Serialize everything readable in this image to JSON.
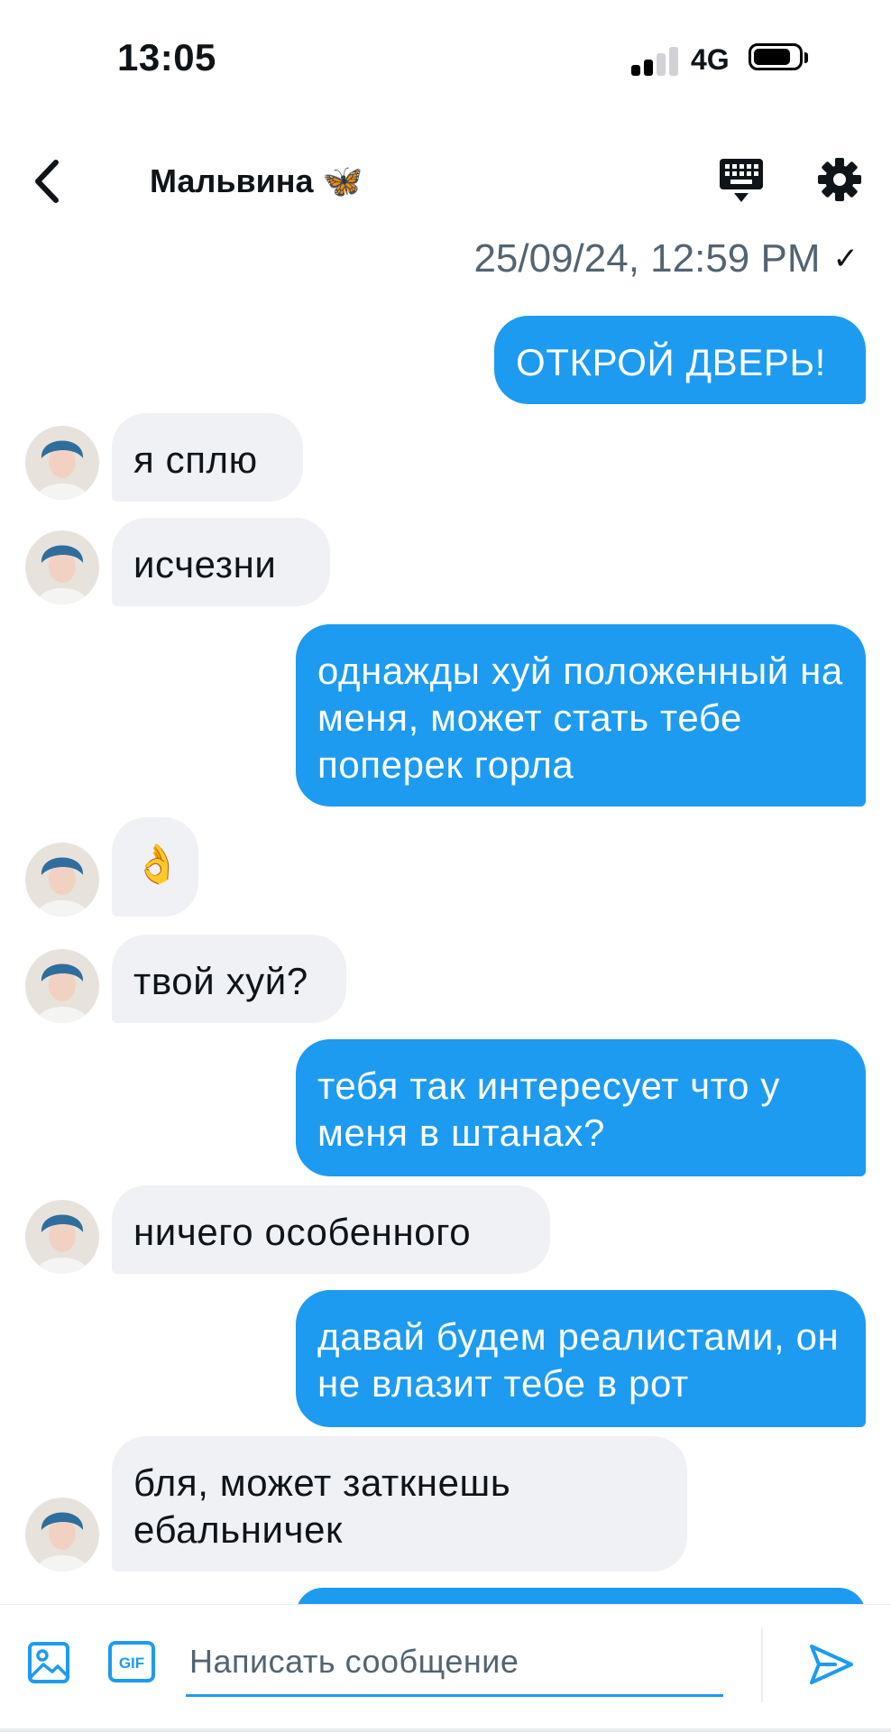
{
  "status_bar": {
    "time": "13:05",
    "network": "4G"
  },
  "header": {
    "title": "Мальвина 🦋"
  },
  "conversation": {
    "timestamp": "25/09/24, 12:59 PM",
    "read_mark": "✓",
    "messages": [
      {
        "dir": "out",
        "text": "ОТКРОЙ ДВЕРЬ!"
      },
      {
        "dir": "in",
        "text": "я сплю"
      },
      {
        "dir": "in",
        "text": "исчезни"
      },
      {
        "dir": "out",
        "text": "однажды хуй положенный на меня, может стать тебе поперек горла"
      },
      {
        "dir": "in",
        "text": "👌"
      },
      {
        "dir": "in",
        "text": "твой хуй?"
      },
      {
        "dir": "out",
        "text": "тебя так интересует что у меня в штанах?"
      },
      {
        "dir": "in",
        "text": "ничего особенного"
      },
      {
        "dir": "out",
        "text": "давай будем реалистами, он не влазит тебе в рот"
      },
      {
        "dir": "in",
        "text": "бля, может заткнешь ебальничек"
      }
    ]
  },
  "composer": {
    "placeholder": "Написать сообщение",
    "gif_label": "GIF"
  },
  "colors": {
    "accent": "#1d9bf0",
    "incoming_bubble": "#eff1f5",
    "muted_text": "#536471"
  }
}
